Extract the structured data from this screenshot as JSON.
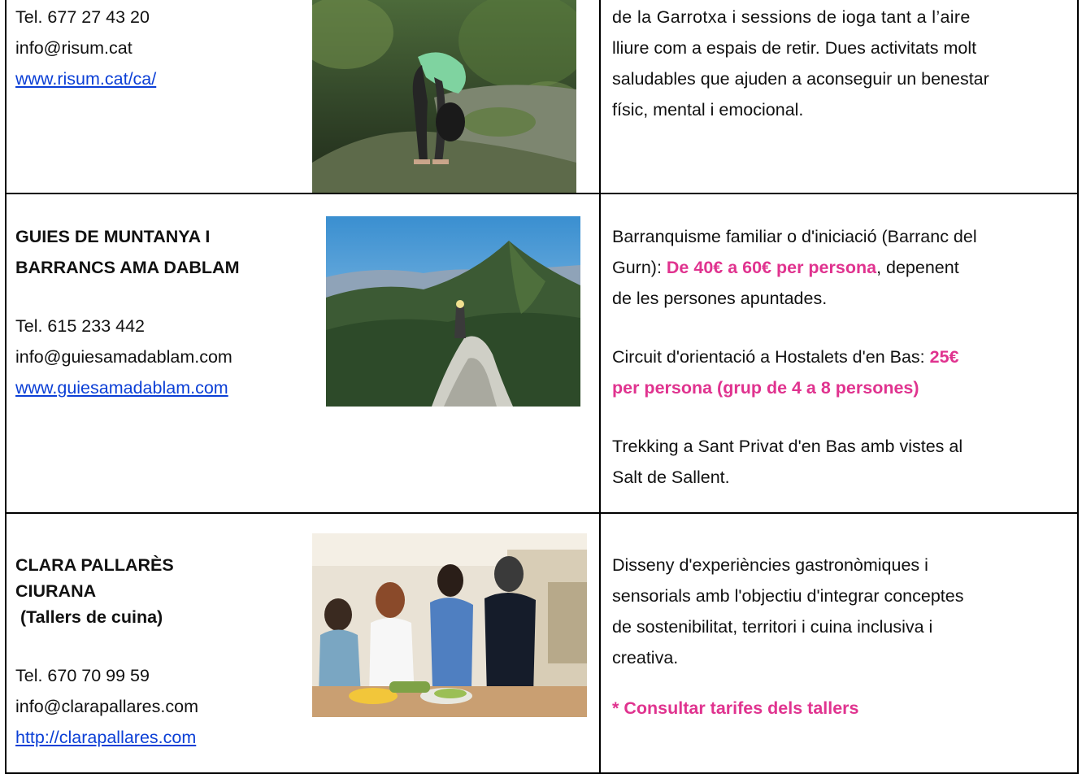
{
  "row1": {
    "phone": "Tel. 677 27 43 20",
    "email": "info@risum.cat",
    "website": "www.risum.cat/ca/",
    "description_lines": [
      "de la Garrotxa i sessions de ioga tant a l’aire",
      "lliure com a espais de retir. Dues activitats molt",
      "saludables que ajuden a aconseguir un benestar",
      "físic, mental i emocional."
    ]
  },
  "row2": {
    "name_lines": [
      "GUIES DE MUNTANYA I",
      "BARRANCS AMA DABLAM"
    ],
    "phone": "Tel. 615 233 442",
    "email": "info@guiesamadablam.com",
    "website": "www.guiesamadablam.com",
    "offer1": {
      "line1": "Barranquisme familiar o d'iniciació (Barranc del",
      "line2_prefix": "Gurn): ",
      "line2_price": "De 40€ a 60€ per persona",
      "line2_suffix": ", depenent",
      "line3": "de les persones apuntades."
    },
    "offer2": {
      "line1_prefix": "Circuit d'orientació a Hostalets d'en Bas: ",
      "line1_price": "25€",
      "line2_price": "per persona (grup de 4 a 8 persones)"
    },
    "offer3_lines": [
      "Trekking a Sant Privat d'en Bas amb vistes al",
      "Salt de Sallent."
    ]
  },
  "row3": {
    "name_lines": [
      "CLARA PALLARÈS",
      "CIURANA",
      " (Tallers de cuina)"
    ],
    "phone": "Tel. 670 70 99 59",
    "email": "info@clarapallares.com",
    "website": "http://clarapallares.com",
    "description_lines": [
      "Disseny d'experiències gastronòmiques i",
      "sensorials amb l'objectiu d'integrar conceptes",
      "de sostenibilitat, territori i cuina inclusiva i",
      "creativa."
    ],
    "note": "* Consultar tarifes dels tallers"
  },
  "colors": {
    "link": "#0b3fd6",
    "highlight": "#e0338f",
    "border": "#000000"
  }
}
